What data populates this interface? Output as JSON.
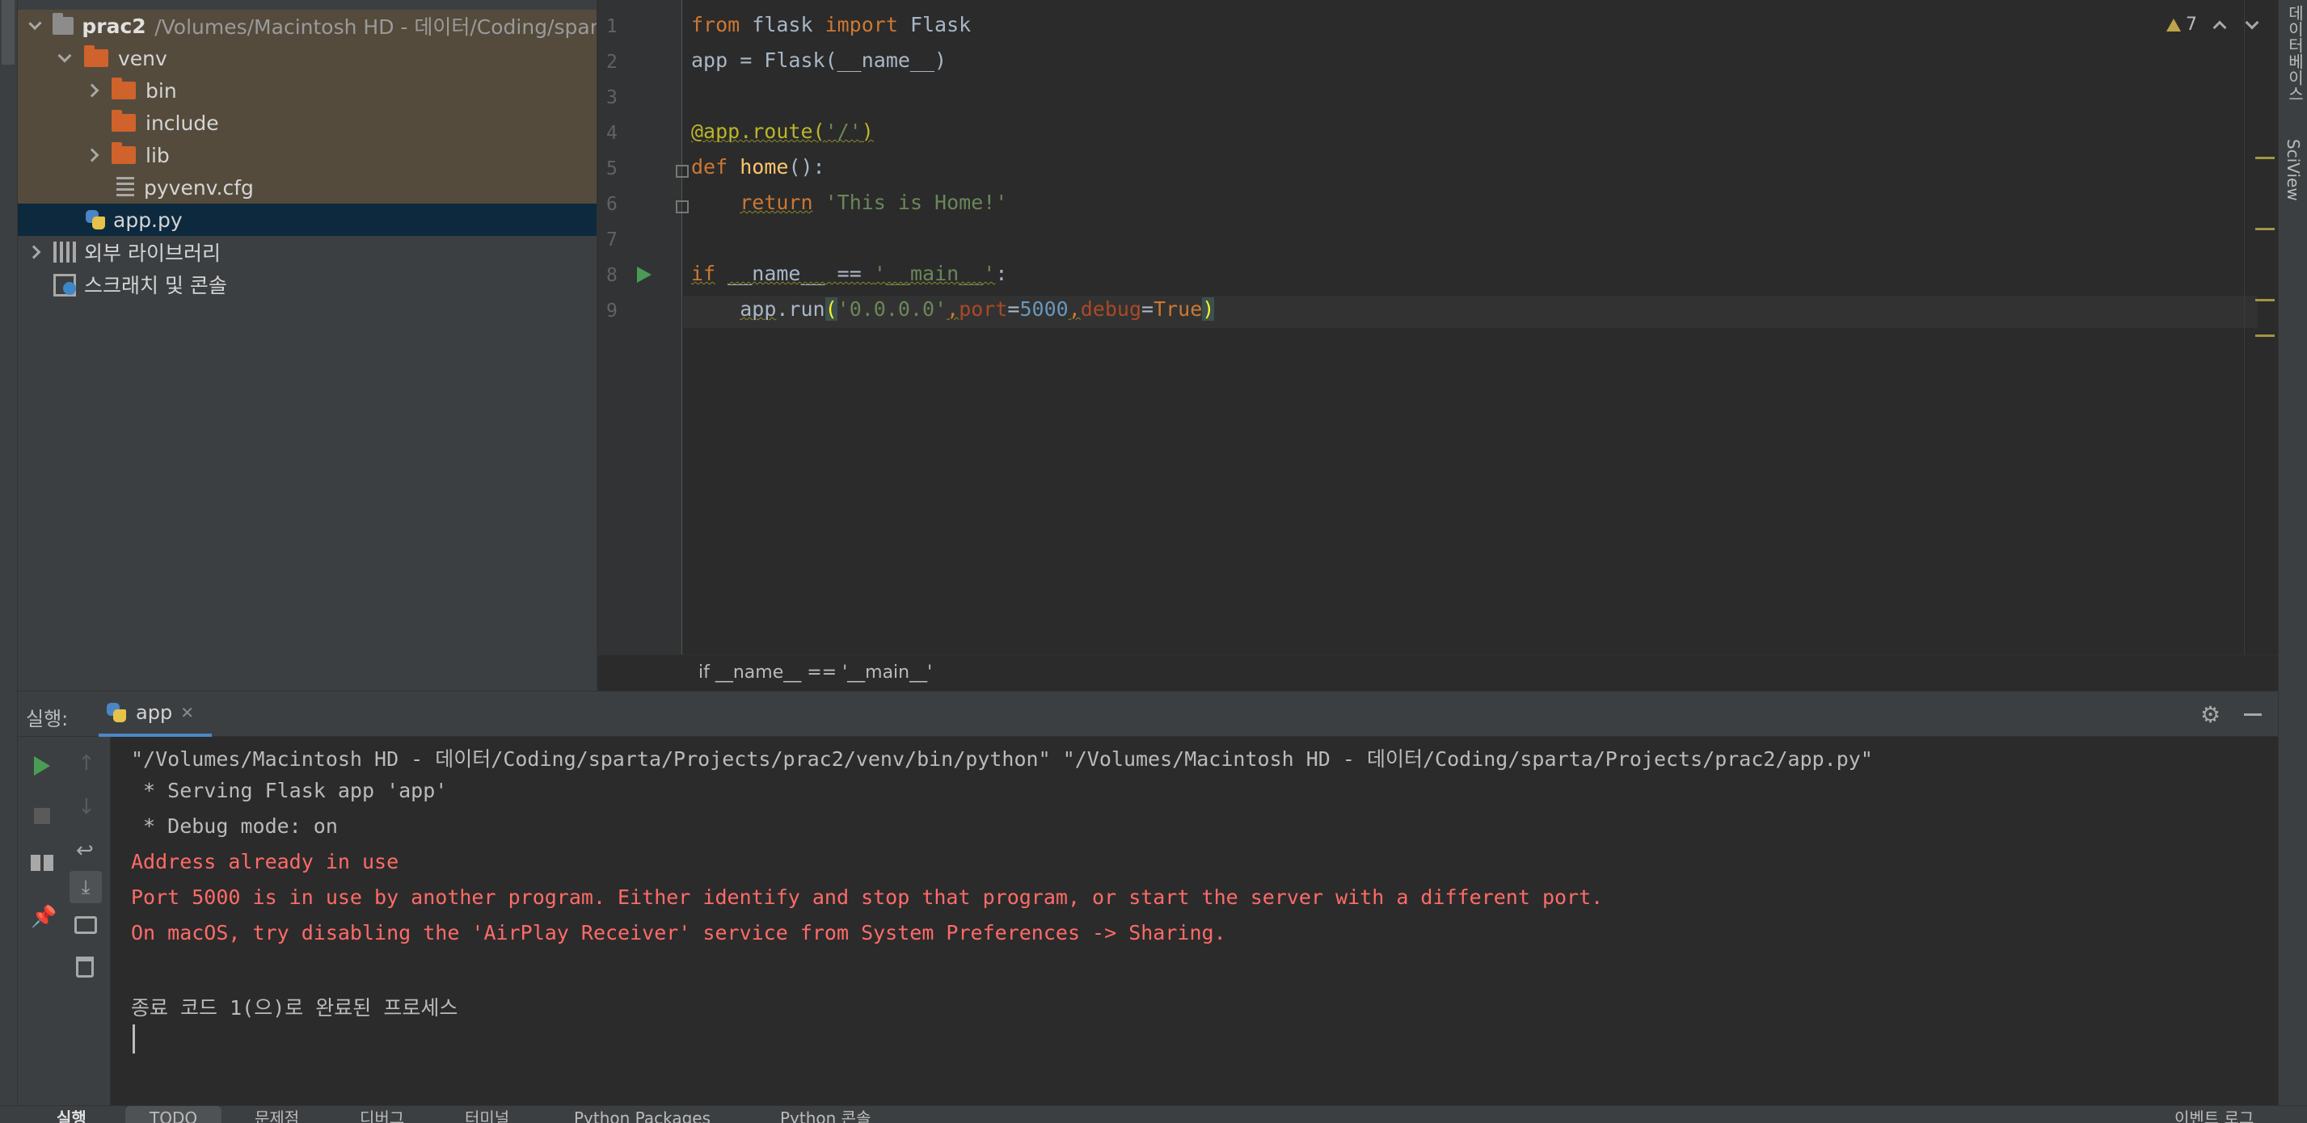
{
  "project_tree": {
    "root": {
      "name": "prac2",
      "path": "/Volumes/Macintosh HD - 데이터/Coding/spar"
    },
    "venv": {
      "name": "venv"
    },
    "bin": {
      "name": "bin"
    },
    "include": {
      "name": "include"
    },
    "lib": {
      "name": "lib"
    },
    "pyvenv": {
      "name": "pyvenv.cfg"
    },
    "app": {
      "name": "app.py"
    },
    "external": {
      "name": "외부 라이브러리"
    },
    "scratches": {
      "name": "스크래치 및 콘솔"
    }
  },
  "editor": {
    "line_numbers": [
      "1",
      "2",
      "3",
      "4",
      "5",
      "6",
      "7",
      "8",
      "9"
    ],
    "inspection_count": "7",
    "breadcrumb": "if __name__ == '__main__'"
  },
  "code": {
    "l1": {
      "kw1": "from",
      "mod": " flask ",
      "kw2": "import",
      "name": " Flask"
    },
    "l2": {
      "text": "app = Flask(__name__)"
    },
    "l4": {
      "deco": "@app.route(",
      "arg": "'/'",
      "close": ")"
    },
    "l5": {
      "kw": "def",
      "sp": " ",
      "fn": "home",
      "rest": "():"
    },
    "l6": {
      "indent": "    ",
      "kw": "return",
      "sp": " ",
      "str": "'This is Home!'"
    },
    "l8": {
      "kw": "if",
      "sp1": " ",
      "name": "__name__",
      "op": " == ",
      "str": "'__main__'",
      "colon": ":"
    },
    "l9": {
      "indent": "    ",
      "obj": "app",
      "call": ".run",
      "open": "(",
      "host": "'0.0.0.0'",
      "c1": ",",
      "p1": "port",
      "eq1": "=",
      "port": "5000",
      "c2": ",",
      "p2": "debug",
      "eq2": "=",
      "debug": "True",
      "close": ")"
    }
  },
  "run_panel": {
    "label": "실행:",
    "tab": "app",
    "output": [
      {
        "text": "\"/Volumes/Macintosh HD - 데이터/Coding/sparta/Projects/prac2/venv/bin/python\" \"/Volumes/Macintosh HD - 데이터/Coding/sparta/Projects/prac2/app.py\"",
        "type": "norm"
      },
      {
        "text": " * Serving Flask app 'app'",
        "type": "norm"
      },
      {
        "text": " * Debug mode: on",
        "type": "norm"
      },
      {
        "text": "Address already in use",
        "type": "err"
      },
      {
        "text": "Port 5000 is in use by another program. Either identify and stop that program, or start the server with a different port.",
        "type": "err"
      },
      {
        "text": "On macOS, try disabling the 'AirPlay Receiver' service from System Preferences -> Sharing.",
        "type": "err"
      },
      {
        "text": "",
        "type": "norm"
      },
      {
        "text": "종료 코드 1(으)로 완료된 프로세스",
        "type": "norm"
      }
    ]
  },
  "right_strip": {
    "database": "데이터베이스",
    "sciview": "SciView"
  },
  "bottom_bar": {
    "run": "실행",
    "todo": "TODO",
    "problems": "문제점",
    "debug": "디버그",
    "terminal": "터미널",
    "packages": "Python Packages",
    "console": "Python 콘솔",
    "event_log": "이벤트 로그"
  },
  "colors": {
    "accent": "#4a88c7",
    "error": "#ff6b68",
    "run_green": "#499c54",
    "folder": "#d0622c"
  }
}
